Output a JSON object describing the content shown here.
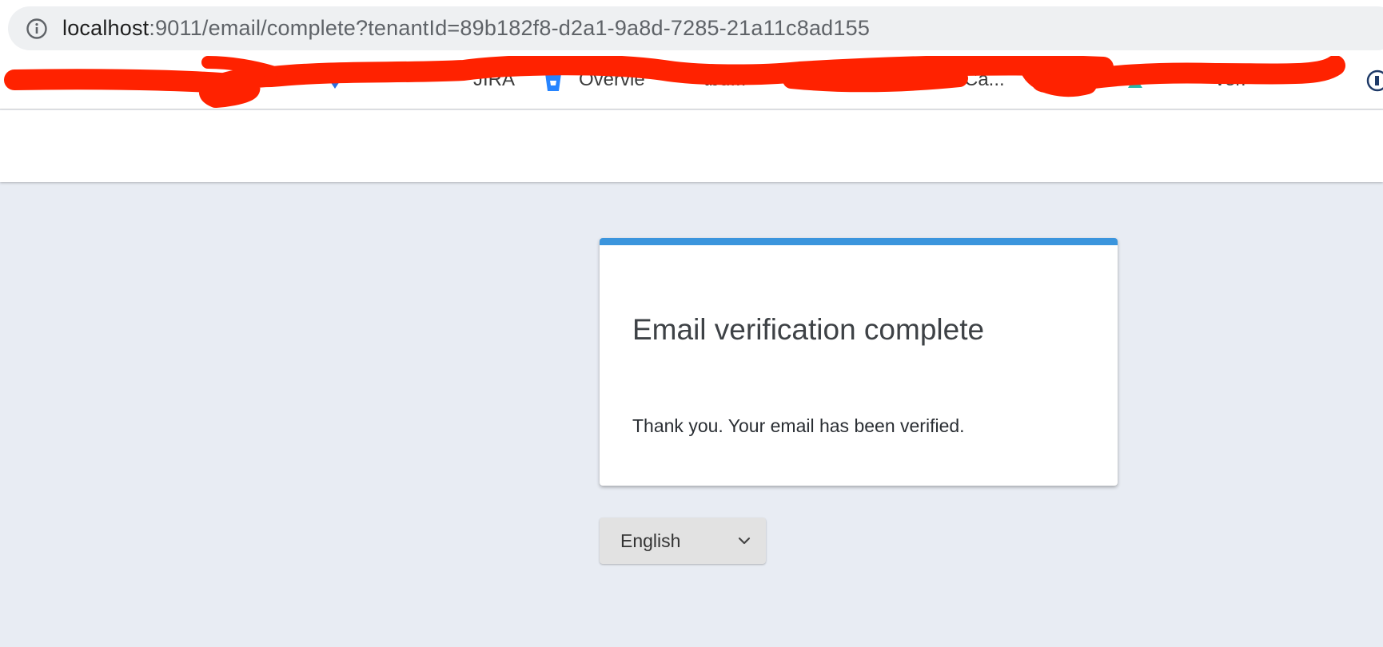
{
  "browser": {
    "url_host": "localhost",
    "url_rest": ":9011/email/complete?tenantId=89b182f8-d2a1-9a8d-7285-21a11c8ad155",
    "info_icon": "info-icon",
    "bookmarks": [
      {
        "label": "JIRA",
        "icon": "jira-icon"
      },
      {
        "label": "Overvie",
        "icon": "bitbucket-icon"
      },
      {
        "label": "tbu...",
        "icon": ""
      },
      {
        "label": "Ca...",
        "icon": ""
      },
      {
        "label": "ver.",
        "icon": "confluence-icon"
      }
    ]
  },
  "panel": {
    "title": "Email verification complete",
    "message": "Thank you. Your email has been verified.",
    "accent_color": "#3b95dd"
  },
  "locale": {
    "selected": "English",
    "icon": "chevron-down-icon"
  }
}
